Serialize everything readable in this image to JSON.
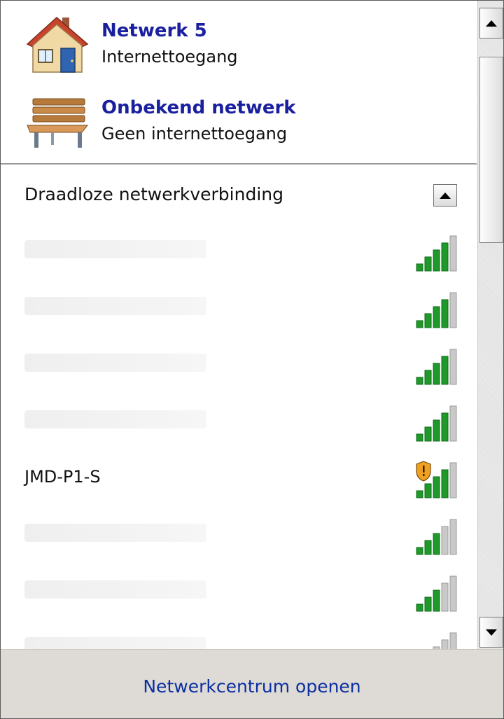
{
  "connections": [
    {
      "name": "Netwerk  5",
      "status": "Internettoegang",
      "icon": "house-icon"
    },
    {
      "name": "Onbekend netwerk",
      "status": "Geen internettoegang",
      "icon": "bench-icon"
    }
  ],
  "wireless": {
    "header": "Draadloze netwerkverbinding",
    "networks": [
      {
        "name": "",
        "blurred": true,
        "secured": false,
        "signal_bars": 4
      },
      {
        "name": "",
        "blurred": true,
        "secured": false,
        "signal_bars": 4
      },
      {
        "name": "",
        "blurred": true,
        "secured": false,
        "signal_bars": 4
      },
      {
        "name": "",
        "blurred": true,
        "secured": false,
        "signal_bars": 4
      },
      {
        "name": "JMD-P1-S",
        "blurred": false,
        "secured": true,
        "signal_bars": 4
      },
      {
        "name": "",
        "blurred": true,
        "secured": false,
        "signal_bars": 3
      },
      {
        "name": "",
        "blurred": true,
        "secured": false,
        "signal_bars": 3
      },
      {
        "name": "",
        "blurred": true,
        "secured": false,
        "signal_bars": 2
      }
    ]
  },
  "footer": {
    "link": "Netwerkcentrum openen"
  },
  "colors": {
    "link": "#0b2fa0",
    "connection_name": "#1a1fa0",
    "signal_green": "#1f9a2a",
    "footer_bg": "#dedad6"
  }
}
